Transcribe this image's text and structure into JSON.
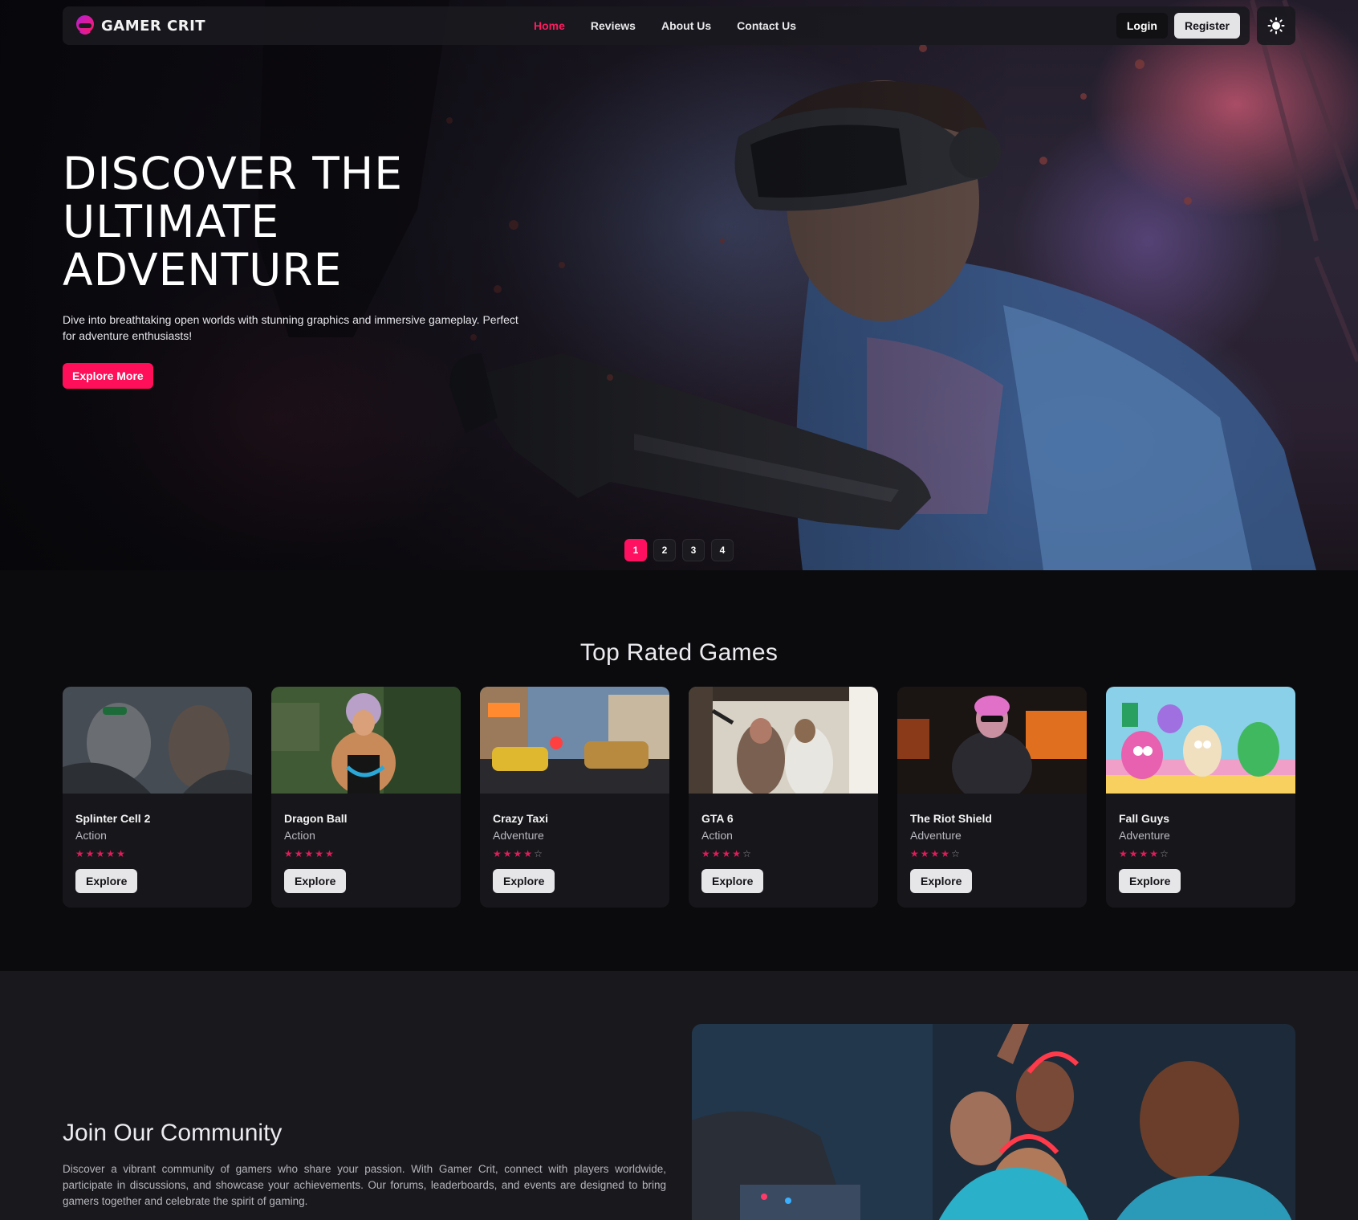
{
  "brand": {
    "name": "GAMER CRIT"
  },
  "nav": {
    "links": [
      {
        "label": "Home",
        "active": true
      },
      {
        "label": "Reviews",
        "active": false
      },
      {
        "label": "About Us",
        "active": false
      },
      {
        "label": "Contact Us",
        "active": false
      }
    ],
    "login_label": "Login",
    "register_label": "Register",
    "theme_icon": "sun-icon"
  },
  "hero": {
    "title_lines": [
      "DISCOVER THE",
      "ULTIMATE",
      "ADVENTURE"
    ],
    "subtitle": "Dive into breathtaking open worlds with stunning graphics and immersive gameplay. Perfect for adventure enthusiasts!",
    "cta_label": "Explore More",
    "slides": [
      "1",
      "2",
      "3",
      "4"
    ],
    "active_slide": 1
  },
  "top_rated": {
    "title": "Top Rated Games",
    "games": [
      {
        "title": "Splinter Cell 2",
        "genre": "Action",
        "rating": 5,
        "button": "Explore"
      },
      {
        "title": "Dragon Ball",
        "genre": "Action",
        "rating": 5,
        "button": "Explore"
      },
      {
        "title": "Crazy Taxi",
        "genre": "Adventure",
        "rating": 4,
        "button": "Explore"
      },
      {
        "title": "GTA 6",
        "genre": "Action",
        "rating": 4,
        "button": "Explore"
      },
      {
        "title": "The Riot Shield",
        "genre": "Adventure",
        "rating": 4,
        "button": "Explore"
      },
      {
        "title": "Fall Guys",
        "genre": "Adventure",
        "rating": 4,
        "button": "Explore"
      }
    ]
  },
  "community": {
    "title": "Join Our Community",
    "description": "Discover a vibrant community of gamers who share your passion. With Gamer Crit, connect with players worldwide, participate in discussions, and showcase your achievements. Our forums, leaderboards, and events are designed to bring gamers together and celebrate the spirit of gaming."
  },
  "colors": {
    "accent": "#ff0f5a",
    "background": "#0b0b0e",
    "card": "#17171b",
    "star": "#e11c5a"
  }
}
